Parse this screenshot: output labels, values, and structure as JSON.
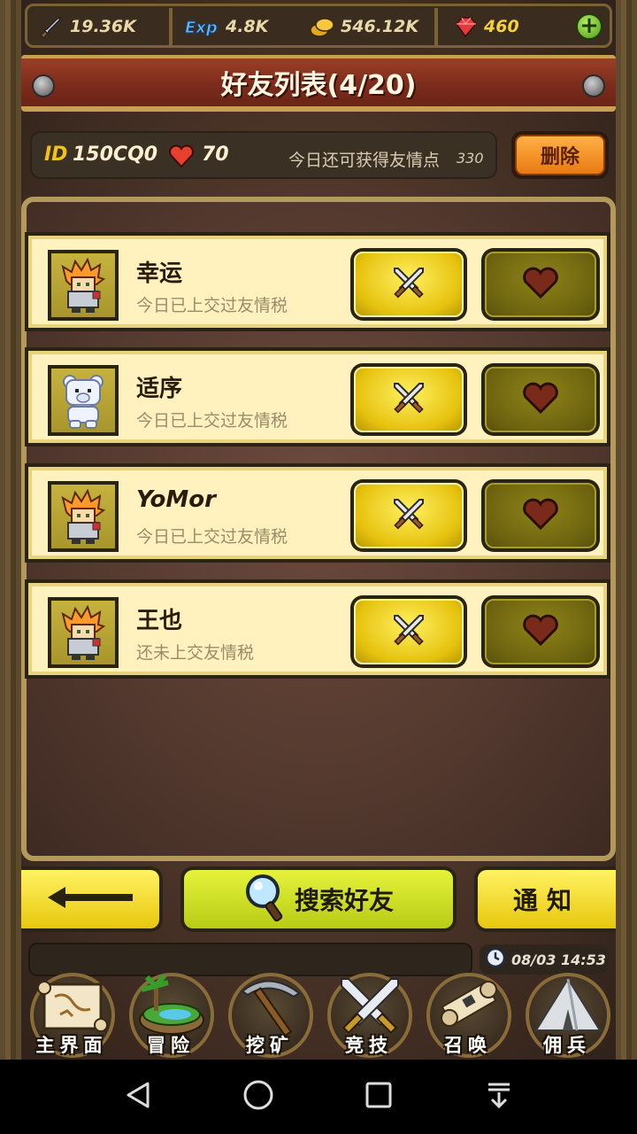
{
  "resources": {
    "attack": "19.36K",
    "exp": "4.8K",
    "gold": "546.12K",
    "gems": "460"
  },
  "title": "好友列表(4/20)",
  "player": {
    "id_label": "ID",
    "id_value": "150CQ0",
    "hearts": "70",
    "friend_points_text": "今日还可获得友情点",
    "friend_points_value": "330"
  },
  "delete_label": "删除",
  "friends": [
    {
      "name": "幸运",
      "status": "今日已上交过友情税",
      "avatar": "orange-hair-knight"
    },
    {
      "name": "适序",
      "status": "今日已上交过友情税",
      "avatar": "white-bear"
    },
    {
      "name": "YoMor",
      "status": "今日已上交过友情税",
      "avatar": "orange-hair-knight"
    },
    {
      "name": "王也",
      "status": "还未上交友情税",
      "avatar": "orange-hair-knight"
    }
  ],
  "buttons": {
    "search": "搜索好友",
    "notice": "通知"
  },
  "time": "08/03 14:53",
  "nav": [
    {
      "label": "主界面",
      "icon": "scroll-map-icon"
    },
    {
      "label": "冒险",
      "icon": "island-icon"
    },
    {
      "label": "挖矿",
      "icon": "pickaxe-icon"
    },
    {
      "label": "竞技",
      "icon": "crossed-swords-icon"
    },
    {
      "label": "召唤",
      "icon": "summon-scroll-icon"
    },
    {
      "label": "佣兵",
      "icon": "tent-icon"
    }
  ],
  "colors": {
    "title_red": "#7c2c1c",
    "row_bg": "#fff2bf",
    "fight_yellow": "#e6c20e",
    "heart_olive": "#6e6410",
    "search_green": "#b8cc16"
  }
}
